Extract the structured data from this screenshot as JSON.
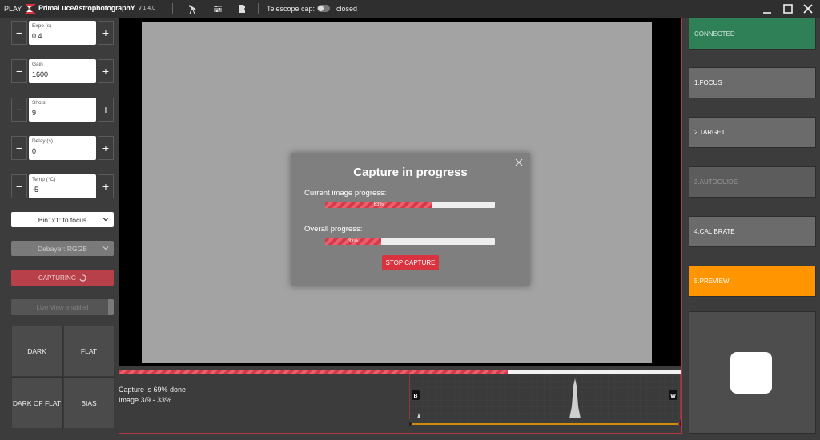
{
  "titlebar": {
    "play_label": "PLAY",
    "brand": "PrimaLuceAstrophotographY",
    "version": "v 1.4.0",
    "telescope_cap_label": "Telescope cap:",
    "telescope_cap_value": "closed"
  },
  "left_panel": {
    "steppers": [
      {
        "label": "Expo (s)",
        "value": "0.4"
      },
      {
        "label": "Gain",
        "value": "1600"
      },
      {
        "label": "Shots",
        "value": "9"
      },
      {
        "label": "Delay (s)",
        "value": "0"
      },
      {
        "label": "Temp (°C)",
        "value": "-5"
      }
    ],
    "minus_symbol": "−",
    "plus_symbol": "+",
    "binning_select": "Bin1x1: to focus",
    "debayer_select": "Debayer: RGGB",
    "capturing_label": "CAPTURING",
    "live_view_label": "Live View enabled",
    "frame_buttons": [
      "DARK",
      "FLAT",
      "DARK OF FLAT",
      "BIAS"
    ]
  },
  "dialog": {
    "title": "Capture in progress",
    "current_label": "Current image progress:",
    "current_percent": 63,
    "current_text": "63%",
    "overall_label": "Overall progress:",
    "overall_percent": 33,
    "overall_text": "33%",
    "stop_button": "STOP CAPTURE"
  },
  "status": {
    "capture_done": "Capture is 69% done",
    "image_count": "Image 3/9 - 33%",
    "overall_strip_percent": 69
  },
  "histogram": {
    "black_marker": "B",
    "white_marker": "W"
  },
  "right_panel": {
    "buttons": [
      "CONNECTED",
      "1.FOCUS",
      "2.TARGET",
      "3.AUTOGUIDE",
      "4.CALIBRATE",
      "5.PREVIEW"
    ]
  },
  "colors": {
    "accent_red": "#d8333f",
    "connected_green": "#2f8056",
    "preview_orange": "#ff9500"
  }
}
